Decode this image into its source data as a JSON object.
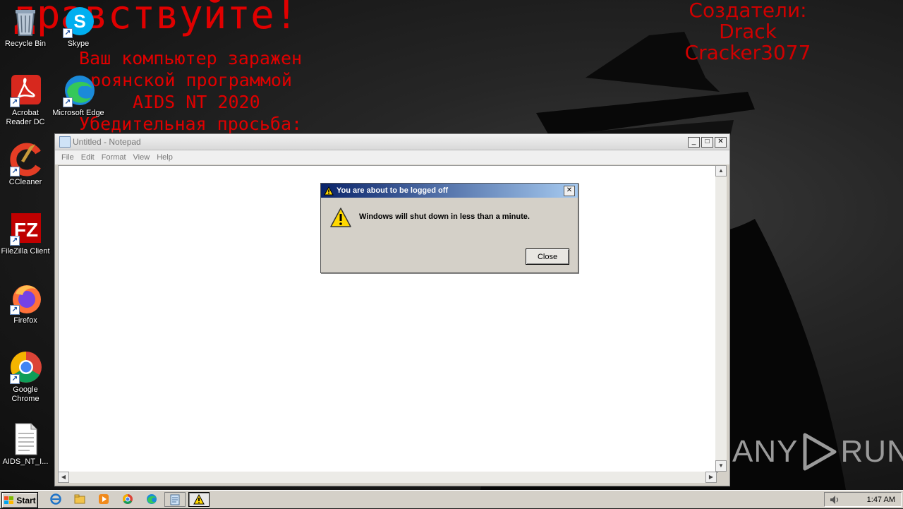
{
  "wallpaper": {
    "greeting": "дравствуйте!",
    "lines": [
      "Ваш компьютер заражен",
      "роянской программой",
      "AIDS NT 2020",
      "Убедительная просьба:"
    ],
    "creators": [
      "Создатели:",
      "Drack",
      "Cracker3077"
    ],
    "watermark_left": "ANY",
    "watermark_right": "RUN"
  },
  "desktop_icons": [
    {
      "label": "Recycle Bin"
    },
    {
      "label": "Skype"
    },
    {
      "label": "Acrobat Reader DC"
    },
    {
      "label": "Microsoft Edge"
    },
    {
      "label": "CCleaner"
    },
    {
      "label": "FileZilla Client"
    },
    {
      "label": "Firefox"
    },
    {
      "label": "Google Chrome"
    },
    {
      "label": "AIDS_NT_I..."
    }
  ],
  "notepad": {
    "title": "Untitled - Notepad",
    "menu": [
      "File",
      "Edit",
      "Format",
      "View",
      "Help"
    ]
  },
  "dialog": {
    "title": "You are about to be logged off",
    "message": "Windows will shut down in less than a minute.",
    "close_label": "Close"
  },
  "taskbar": {
    "start_label": "Start",
    "clock": "1:47 AM"
  },
  "colors": {
    "wallpaper_text": "#e00000",
    "dialog_title_start": "#0a246a",
    "dialog_title_end": "#a6caf0",
    "taskbar": "#d4d0c8"
  }
}
